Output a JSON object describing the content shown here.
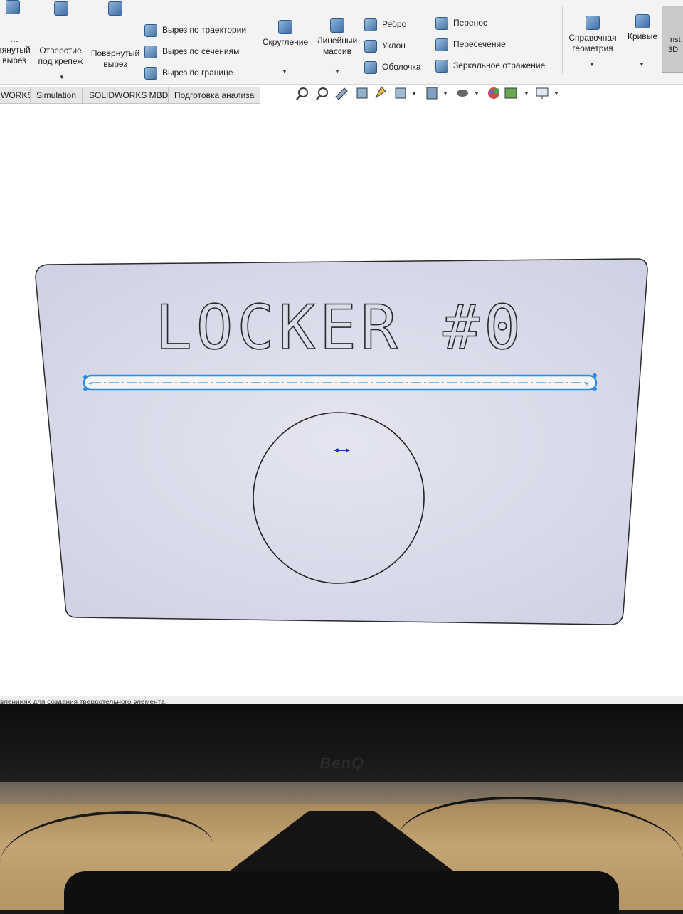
{
  "ribbon": {
    "extrude_cut": "…тянутый вырез",
    "hole_wizard": "Отверстие под крепеж",
    "revolved_cut": "Повернутый вырез",
    "swept_cut": "Вырез по траектории",
    "lofted_cut": "Вырез по сечениям",
    "boundary_cut": "Вырез по границе",
    "fillet": "Скругление",
    "linear_pattern": "Линейный массив",
    "rib": "Ребро",
    "draft": "Уклон",
    "shell": "Оболочка",
    "wrap": "Перенос",
    "intersect": "Пересечение",
    "mirror": "Зеркальное отражение",
    "ref_geometry": "Справочная геометрия",
    "curves": "Кривые",
    "instant3d": "Inst 3D"
  },
  "tabs": [
    "WORKS",
    "Simulation",
    "SOLIDWORKS MBD",
    "Подготовка анализа"
  ],
  "hud_icons": [
    "zoom-to-fit-icon",
    "zoom-area-icon",
    "previous-view-icon",
    "section-view-icon",
    "dynamic-annotation-icon",
    "view-orientation-icon",
    "display-style-icon",
    "hide-show-icon",
    "edit-appearance-icon",
    "apply-scene-icon",
    "view-settings-icon"
  ],
  "sketch": {
    "plate_text": "LOCKER #0",
    "plate_fill": "#d6d8ea",
    "slot_color": "#2b8be0",
    "circle_color": "#222222"
  },
  "status_bar": {
    "text": "вленииях для создания твердотельного элемента."
  },
  "monitor": {
    "brand": "BenQ"
  }
}
